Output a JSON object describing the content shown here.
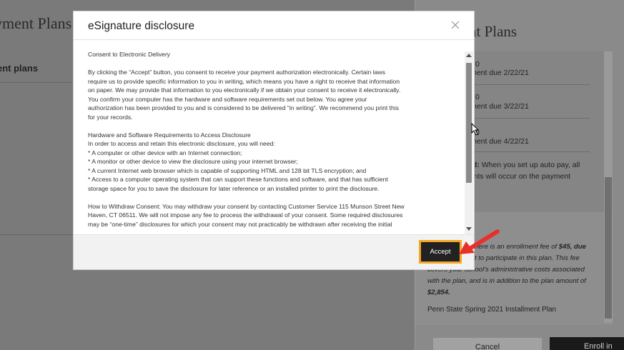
{
  "background": {
    "title": "yment Plans",
    "subtitle": "ent plans"
  },
  "side_panel": {
    "title": "nt Plans",
    "payments": [
      {
        "amount": "0",
        "due": "nent due 2/22/21"
      },
      {
        "amount": "0",
        "due": "nent due 3/22/21"
      },
      {
        "amount": "0",
        "due": "nent due 4/22/21"
      }
    ],
    "autopay_bold": "red:",
    "autopay_text": " When you set up auto pay, all",
    "autopay_text2": "nents will occur on the payment",
    "fee_line1": "here is an enrollment fee of ",
    "fee_amount": "$45, due",
    "fee_line2": "t to participate in this plan. This fee",
    "fee_line3": "covers your school's administrative costs associated",
    "fee_line4": "with the plan, and is in addition to the plan amount of",
    "fee_total": "$2,854.",
    "plan_name": "Penn State Spring 2021 Installment Plan",
    "cancel_label": "Cancel",
    "enroll_label": "Enroll in"
  },
  "modal": {
    "title": "eSignature disclosure",
    "accept_label": "Accept",
    "heading": "Consent to Electronic Delivery",
    "para1": [
      "By clicking the “Accept” button, you consent to receive your payment authorization electronically. Certain laws",
      "require us to provide specific information to you in writing, which means you have a right to receive that information",
      "on paper. We may provide that information to you electronically if we obtain your consent to receive it electronically.",
      "You confirm your computer has the hardware and software requirements set out below. You agree your",
      "authorization has been provided to you and is considered to be delivered “in writing”. We recommend you print this",
      "for your records."
    ],
    "para2": [
      "Hardware and Software Requirements to Access Disclosure",
      "In order to access and retain this electronic disclosure, you will need:",
      "* A computer or other device with an Internet connection;",
      "* A monitor or other device to view the disclosure using your internet browser;",
      "* A current Internet web browser which is capable of supporting HTML and 128 bit TLS encryption; and",
      "* Access to a computer operating system that can support these functions and software, and that has sufficient",
      "storage space for you to save the disclosure for later reference or an installed printer to print the disclosure."
    ],
    "para3": [
      "How to Withdraw Consent: You may withdraw your consent by contacting Customer Service 115 Munson Street New",
      "Haven, CT 06511. We will not impose any fee to process the withdrawal of your consent. Some required disclosures",
      "may be “one-time” disclosures for which your consent may not practicably be withdrawn after receiving the initial"
    ]
  },
  "colors": {
    "accept_bg": "#222222",
    "highlight": "#f5a623",
    "arrow": "#e8302a"
  },
  "icons": [
    "close-icon",
    "arrow-annotation-icon",
    "mouse-cursor-icon"
  ]
}
